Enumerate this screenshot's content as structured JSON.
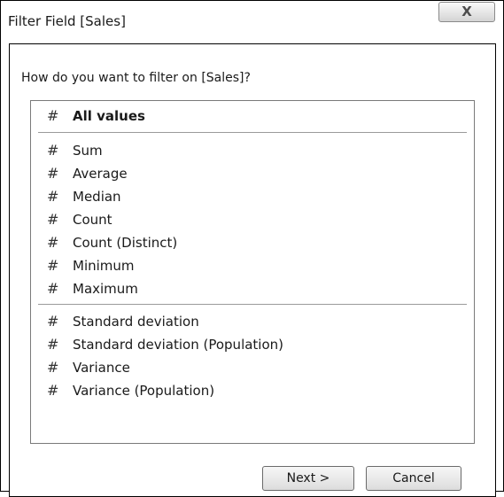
{
  "window": {
    "title": "Filter Field [Sales]",
    "close_glyph": "X"
  },
  "dialog": {
    "prompt": "How do you want to filter on [Sales]?"
  },
  "list": {
    "hash_glyph": "#",
    "items": [
      {
        "label": "All values"
      },
      {
        "label": "Sum"
      },
      {
        "label": "Average"
      },
      {
        "label": "Median"
      },
      {
        "label": "Count"
      },
      {
        "label": "Count (Distinct)"
      },
      {
        "label": "Minimum"
      },
      {
        "label": "Maximum"
      },
      {
        "label": "Standard deviation"
      },
      {
        "label": "Standard deviation (Population)"
      },
      {
        "label": "Variance"
      },
      {
        "label": "Variance (Population)"
      }
    ]
  },
  "buttons": {
    "next_label": "Next >",
    "cancel_label": "Cancel"
  }
}
